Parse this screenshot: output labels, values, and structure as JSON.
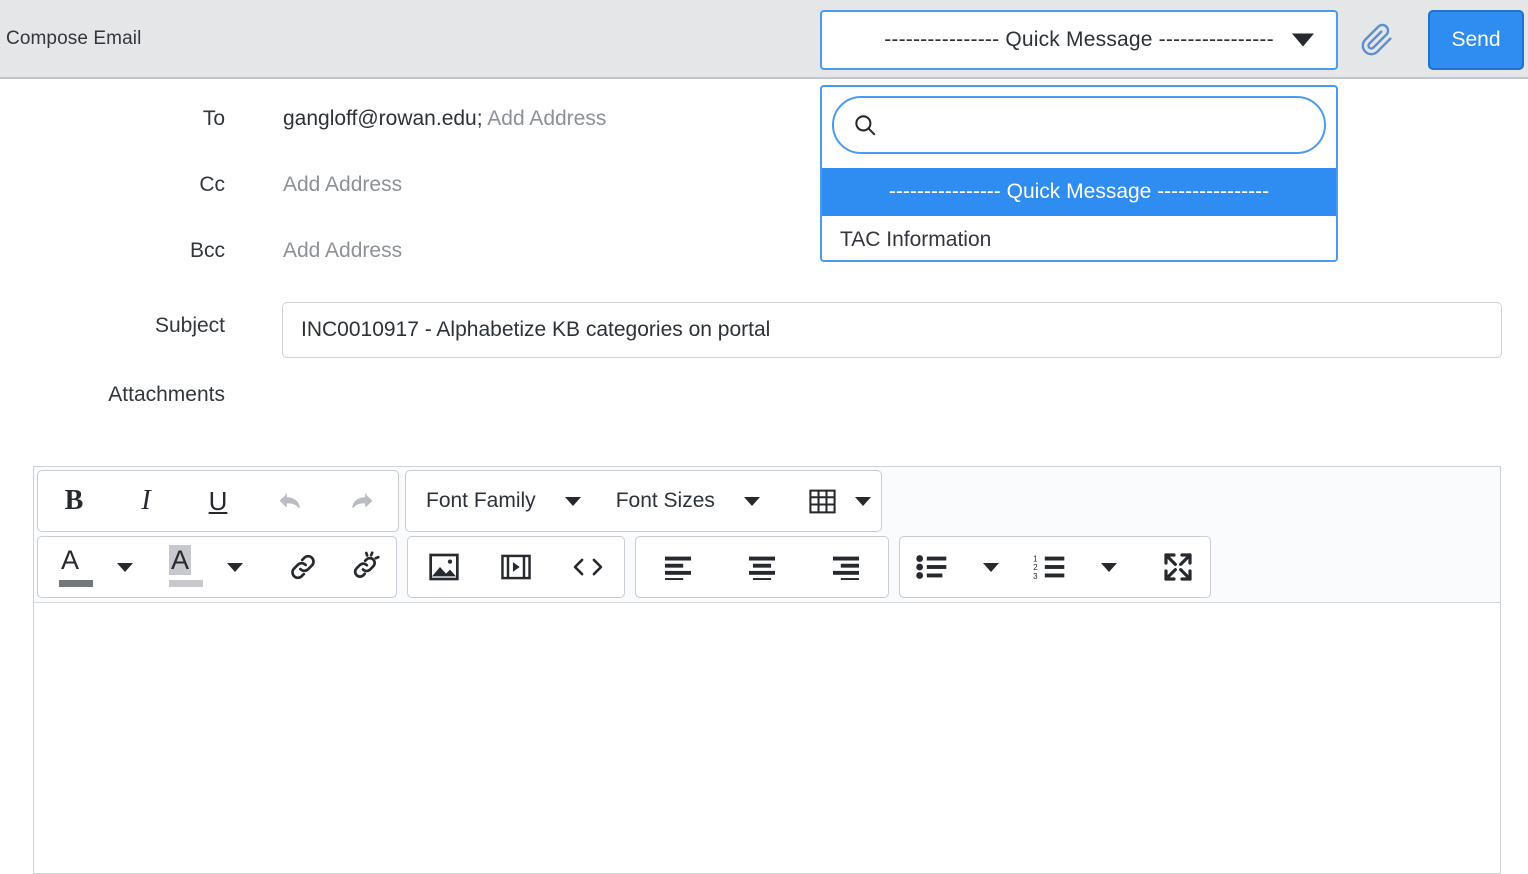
{
  "header": {
    "title": "Compose Email",
    "quick_message_select": {
      "label": "---------------- Quick Message ----------------",
      "caret_icon": "chevron-down-icon"
    },
    "attachment_icon": "paperclip-icon",
    "send_label": "Send"
  },
  "quick_message_dropdown": {
    "search_placeholder": "",
    "search_value": "",
    "search_icon": "search-icon",
    "options": [
      {
        "label": "---------------- Quick Message ----------------",
        "selected": true
      },
      {
        "label": "TAC Information",
        "selected": false
      }
    ]
  },
  "form": {
    "to": {
      "label": "To",
      "value": "gangloff@rowan.edu;",
      "add_label": "Add Address"
    },
    "cc": {
      "label": "Cc",
      "value": "",
      "add_label": "Add Address"
    },
    "bcc": {
      "label": "Bcc",
      "value": "",
      "add_label": "Add Address"
    },
    "subject": {
      "label": "Subject",
      "value": "INC0010917 - Alphabetize KB categories on portal",
      "placeholder": ""
    },
    "attachments": {
      "label": "Attachments"
    }
  },
  "editor": {
    "toolbar_row1": {
      "bold": "B",
      "italic": "I",
      "underline": "U",
      "undo_icon": "undo-arrow-icon",
      "redo_icon": "redo-arrow-icon",
      "font_family": "Font Family",
      "font_sizes": "Font Sizes",
      "table_icon": "table-icon"
    },
    "toolbar_row2": {
      "text_color": "A",
      "background_color": "A",
      "link_icon": "link-icon",
      "unlink_icon": "unlink-icon",
      "image_icon": "image-icon",
      "video_icon": "video-icon",
      "code_icon": "source-code-icon",
      "align_left_icon": "align-left-icon",
      "align_center_icon": "align-center-icon",
      "align_right_icon": "align-right-icon",
      "bullet_list_icon": "bullet-list-icon",
      "numbered_list_icon": "numbered-list-icon",
      "fullscreen_icon": "fullscreen-icon"
    },
    "body_text": ""
  },
  "colors": {
    "accent": "#2f8cf0",
    "header_bg": "#e5e6e8",
    "border": "#cfd2d6",
    "text": "#32373e",
    "placeholder": "#8d9199"
  }
}
